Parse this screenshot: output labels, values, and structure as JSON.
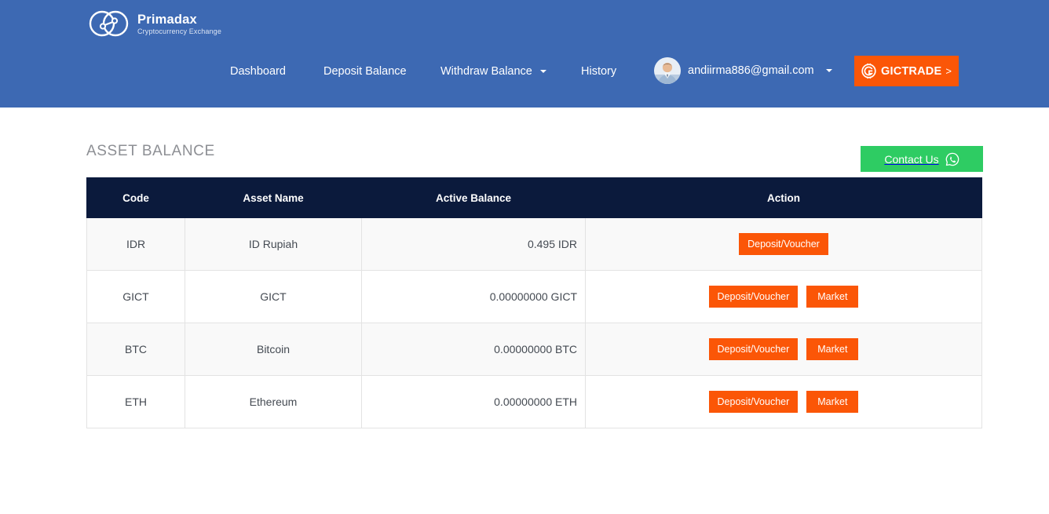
{
  "brand": {
    "name": "Primadax",
    "tagline": "Cryptocurrency Exchange",
    "logo_icon": "two-rings-logo-icon"
  },
  "nav": {
    "items": [
      {
        "label": "Dashboard",
        "icon": ""
      },
      {
        "label": "Deposit Balance",
        "icon": ""
      },
      {
        "label": "Withdraw Balance",
        "icon": "chevron-down-icon"
      },
      {
        "label": "History",
        "icon": ""
      }
    ]
  },
  "user": {
    "email": "andiirma886@gmail.com",
    "avatar_icon": "user-photo-avatar",
    "caret_icon": "chevron-down-icon"
  },
  "gictrade": {
    "label": "GICTRADE",
    "arrow": ">",
    "icon": "gictrade-coin-icon",
    "color": "#fb5607"
  },
  "main": {
    "title": "ASSET BALANCE",
    "contact": {
      "label": "Contact Us",
      "icon": "whatsapp-icon",
      "color": "#2ecc63"
    },
    "table": {
      "columns": [
        "Code",
        "Asset Name",
        "Active Balance",
        "Action"
      ],
      "rows": [
        {
          "code": "IDR",
          "asset_name": "ID Rupiah",
          "active_balance": "0.495 IDR",
          "actions": [
            {
              "label": "Deposit/Voucher"
            }
          ]
        },
        {
          "code": "GICT",
          "asset_name": "GICT",
          "active_balance": "0.00000000 GICT",
          "actions": [
            {
              "label": "Deposit/Voucher"
            },
            {
              "label": "Market"
            }
          ]
        },
        {
          "code": "BTC",
          "asset_name": "Bitcoin",
          "active_balance": "0.00000000 BTC",
          "actions": [
            {
              "label": "Deposit/Voucher"
            },
            {
              "label": "Market"
            }
          ]
        },
        {
          "code": "ETH",
          "asset_name": "Ethereum",
          "active_balance": "0.00000000 ETH",
          "actions": [
            {
              "label": "Deposit/Voucher"
            },
            {
              "label": "Market"
            }
          ]
        }
      ]
    }
  },
  "colors": {
    "header_blue": "#3d69b3",
    "table_header_navy": "#0b1a3c",
    "accent_orange": "#fb5607",
    "whatsapp_green": "#2ecc63",
    "row_stripe": "#f9f9f9"
  }
}
